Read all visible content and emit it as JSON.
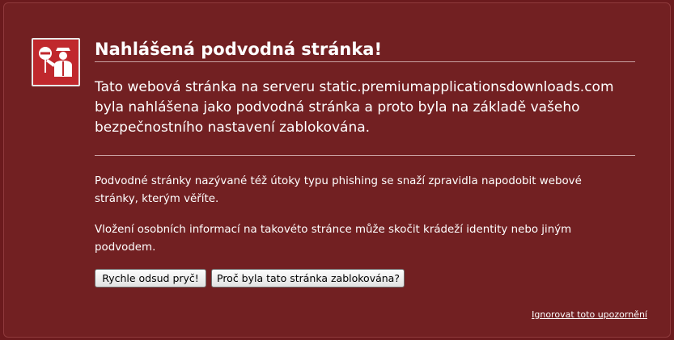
{
  "warning": {
    "title": "Nahlášená podvodná stránka!",
    "lead": "Tato webová stránka na serveru static.premiumapplicationsdownloads.com byla nahlášena jako podvodná stránka a proto byla na základě vašeho bezpečnostního nastavení zablokována.",
    "paragraph1": "Podvodné stránky nazývané též útoky typu phishing se snaží zpravidla napodobit webové stránky, kterým věříte.",
    "paragraph2": "Vložení osobních informací na takovéto stránce může skočit krádeží identity nebo jiným podvodem.",
    "button_leave": "Rychle odsud pryč!",
    "button_why": "Proč byla tato stránka zablokována?",
    "ignore_link": "Ignorovat toto upozornění",
    "icon": "police-officer-stop-icon"
  },
  "colors": {
    "background": "#722022",
    "icon_background": "#c0282d",
    "text": "#ffffff"
  }
}
